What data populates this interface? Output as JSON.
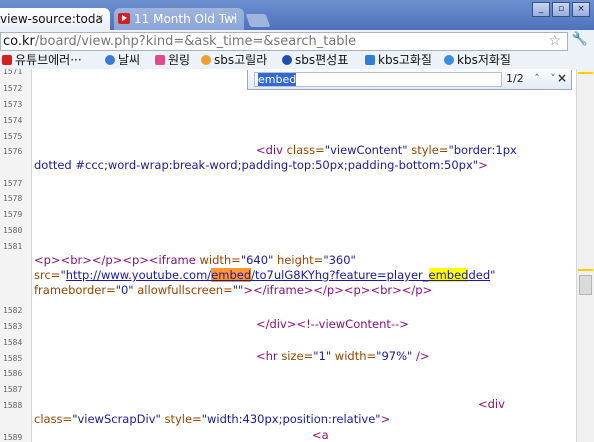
{
  "tabs": [
    {
      "title": "view-source:toda",
      "close": "×"
    },
    {
      "title": "11 Month Old Twi",
      "close": "×"
    }
  ],
  "window_controls": [
    "_",
    "▫",
    "×"
  ],
  "address": {
    "host": "co.kr",
    "path": "/board/view.php?kind=&ask_time=&search_table"
  },
  "bookmarks": [
    {
      "label": "유튜브에러···",
      "icon": "youtube-icon",
      "color": "#d81f1f"
    },
    {
      "label": "날씨",
      "icon": "weather-icon",
      "color": "#3a7bd5"
    },
    {
      "label": "원링",
      "icon": "wonring-icon",
      "color": "#e04c8a"
    },
    {
      "label": "sbs고릴라",
      "icon": "sbs-gorilla-icon",
      "color": "#f0a030"
    },
    {
      "label": "sbs편성표",
      "icon": "sbs-schedule-icon",
      "color": "#1f4fa8"
    },
    {
      "label": "kbs고화질",
      "icon": "kbs-hd-icon",
      "color": "#2e7fd6"
    },
    {
      "label": "kbs저화질",
      "icon": "kbs-ld-icon",
      "color": "#3a8de0"
    }
  ],
  "find": {
    "query": "embed",
    "count": "1/2",
    "prev": "˄",
    "next": "˅",
    "close": "×"
  },
  "line_numbers": [
    "1571",
    "1572",
    "1573",
    "1574",
    "1575",
    "1576",
    "1577",
    "1578",
    "1579",
    "1580",
    "1581",
    "1582",
    "1583",
    "1584",
    "1585",
    "1586",
    "1587",
    "1588",
    "1589"
  ],
  "code": {
    "div_open": "<div ",
    "class_attr": "class=",
    "viewcontent_val": "\"viewContent\"",
    "style_attr": " style=",
    "style_val_1": "\"border:1px",
    "style_val_2": "dotted #ccc;word-wrap:break-word;padding-top:50px;padding-bottom:50px\"",
    "close_bracket": ">",
    "p_br_p": "<p><br></p><p><iframe ",
    "width_attr": "width=",
    "width_val": "\"640\"",
    "height_attr": " height=",
    "height_val": "\"360\"",
    "src_attr": "src=",
    "q": "\"",
    "url_pre": "http://www.youtube.com/",
    "url_hl": "embed",
    "url_post": "/to7ulG8KYhg?feature=player_",
    "url_hl2": "embed",
    "url_end": "ded",
    "fb_attr": "frameborder=",
    "fb_val": "\"0\"",
    "afs_attr": " allowfullscreen=",
    "afs_val": "\"\"",
    "iframe_close": "></iframe></p><p><br></p>",
    "div_close_comment": "</div><!--viewContent-->",
    "hr_open": "<hr ",
    "size_attr": "size=",
    "size_val": "\"1\"",
    "hrwidth_attr": " width=",
    "hrwidth_val": "\"97%\"",
    "self_close": " />",
    "div_tag": "<div",
    "class_attr2": "class=",
    "scrap_val": "\"viewScrapDiv\"",
    "style_attr2": " style=",
    "scrap_style": "\"width:430px;position:relative\"",
    "a_open": "<a"
  }
}
